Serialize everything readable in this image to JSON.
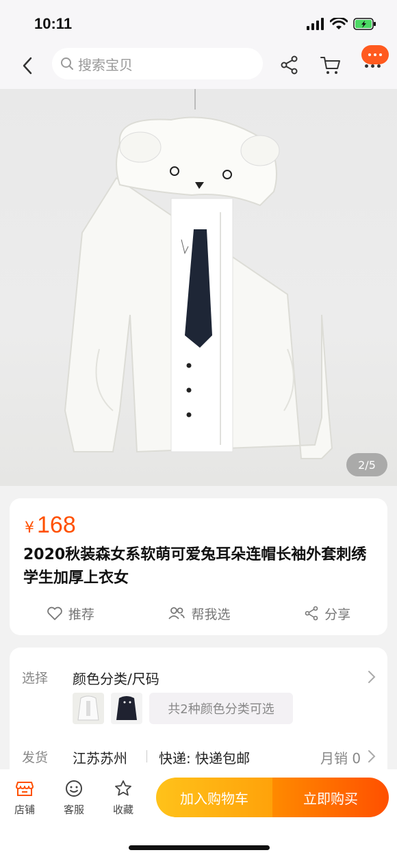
{
  "status_bar": {
    "time": "10:11"
  },
  "nav": {
    "search_placeholder": "搜索宝贝"
  },
  "gallery": {
    "counter": "2/5"
  },
  "product": {
    "currency": "¥",
    "price": "168",
    "title": "2020秋装森女系软萌可爱兔耳朵连帽长袖外套刺绣学生加厚上衣女"
  },
  "actions": [
    {
      "label": "推荐",
      "icon": "heart-icon"
    },
    {
      "label": "帮我选",
      "icon": "people-icon"
    },
    {
      "label": "分享",
      "icon": "share-icon"
    }
  ],
  "options": {
    "select_label": "选择",
    "select_value": "颜色分类/尺码",
    "color_pill": "共2种颜色分类可选",
    "ship_label": "发货",
    "ship_from": "江苏苏州",
    "express": "快递: 快递包邮",
    "monthly_sales": "月销 0"
  },
  "bottom_bar": {
    "tabs": [
      {
        "label": "店铺",
        "icon": "store-icon"
      },
      {
        "label": "客服",
        "icon": "customer-service-icon"
      },
      {
        "label": "收藏",
        "icon": "star-icon"
      }
    ],
    "add_to_cart": "加入购物车",
    "buy_now": "立即购买"
  },
  "colors": {
    "accent": "#ff5000",
    "cart_button": "#ffb30f",
    "badge": "#ff5a1f"
  }
}
